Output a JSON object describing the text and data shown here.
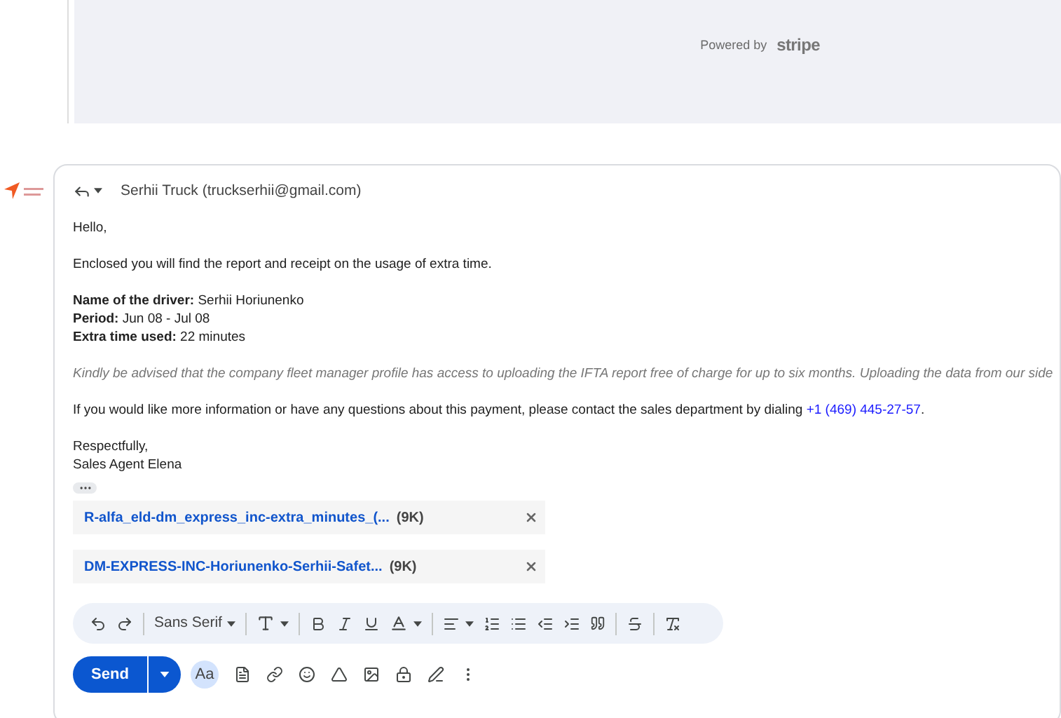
{
  "payment_panel": {
    "powered_by": "Powered by",
    "brand": "stripe"
  },
  "message": {
    "from": "Serhii Truck (truckserhii@gmail.com)",
    "body": [
      {
        "kind": "plain",
        "text": "Hello,"
      },
      {
        "kind": "plain",
        "text": "Enclosed you will find the report and receipt on the usage of extra time."
      },
      {
        "kind": "lines",
        "lines": [
          "**Name of the driver:** Serhii Horiunenko",
          "**Period:** Jun 08 - Jul 08",
          "**Extra time used:** 22 minutes"
        ]
      },
      {
        "kind": "note",
        "text": "Kindly be advised that the company fleet manager profile has access to uploading the IFTA report free of charge for up to six months. Uploading the data from our side"
      },
      {
        "kind": "contact",
        "text": "If you would like more information or have any questions about this payment, please contact the sales department by dialing",
        "link": "+1 (469) 445-27-57",
        "after": "."
      },
      {
        "kind": "lines",
        "lines": [
          "Respectfully,",
          "Sales Agent Elena"
        ]
      }
    ],
    "attachments": [
      {
        "name": "R-alfa_eld-dm_express_inc-extra_minutes_(...",
        "size": "(9K)"
      },
      {
        "name": "DM-EXPRESS-INC-Horiunenko-Serhii-Safet...",
        "size": "(9K)"
      }
    ]
  },
  "toolbar": {
    "font": "Sans Serif"
  },
  "actions": {
    "send": "Send",
    "text_format": "Aa"
  }
}
